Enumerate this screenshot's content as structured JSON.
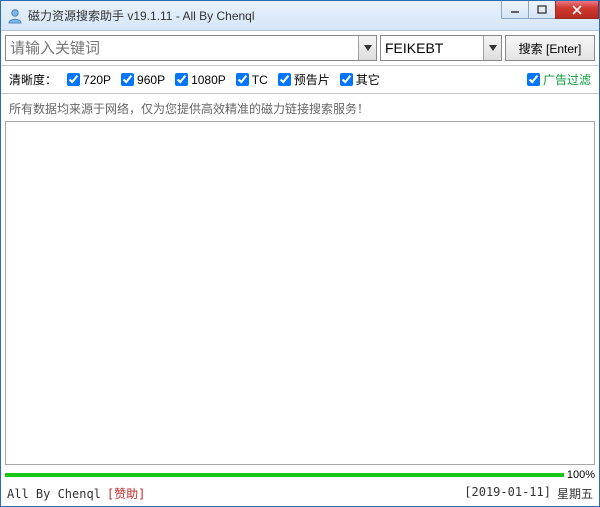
{
  "window": {
    "title": "磁力资源搜索助手 v19.1.11 - All By Chenql"
  },
  "search": {
    "placeholder": "请输入关键词",
    "source_selected": "FEIKEBT",
    "button_label": "搜索 [Enter]"
  },
  "filters": {
    "label": "清晰度：",
    "items": [
      {
        "label": "720P",
        "checked": true
      },
      {
        "label": "960P",
        "checked": true
      },
      {
        "label": "1080P",
        "checked": true
      },
      {
        "label": "TC",
        "checked": true
      },
      {
        "label": "预告片",
        "checked": true
      },
      {
        "label": "其它",
        "checked": true
      }
    ],
    "ad_filter": {
      "label": "广告过滤",
      "checked": true
    }
  },
  "status_message": "所有数据均来源于网络，仅为您提供高效精准的磁力链接搜索服务！",
  "progress": {
    "percent_label": "100%"
  },
  "footer": {
    "author": "All By Chenql",
    "sponsor": "[赞助]",
    "date": "[2019-01-11]",
    "weekday": "星期五"
  }
}
